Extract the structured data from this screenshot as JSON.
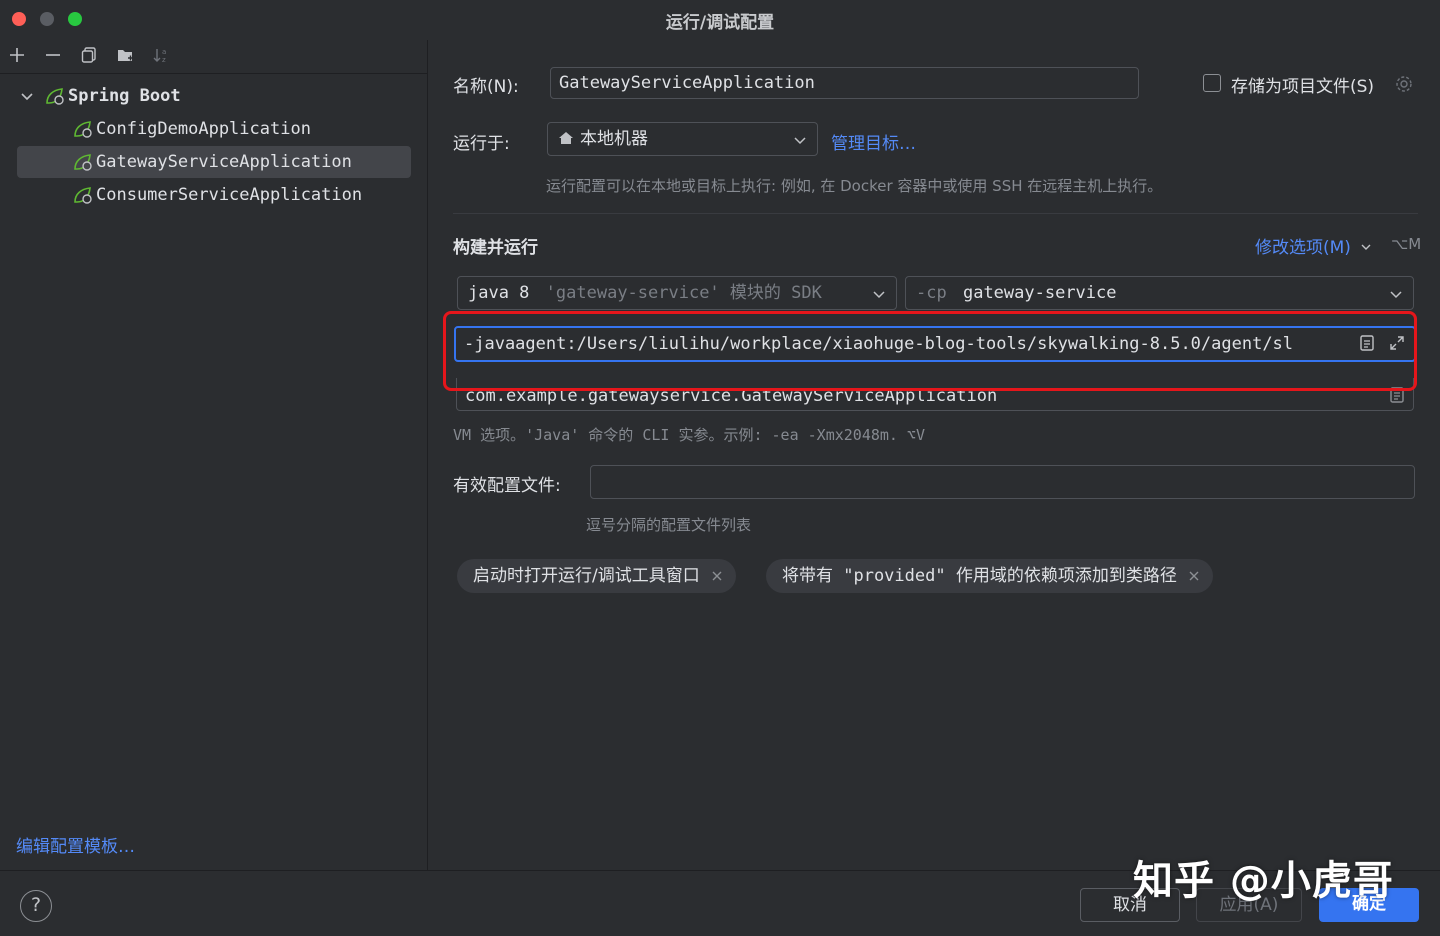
{
  "window": {
    "title": "运行/调试配置"
  },
  "sidebar": {
    "root": {
      "label": "Spring Boot"
    },
    "items": [
      {
        "label": "ConfigDemoApplication",
        "selected": false
      },
      {
        "label": "GatewayServiceApplication",
        "selected": true
      },
      {
        "label": "ConsumerServiceApplication",
        "selected": false
      }
    ],
    "edit_templates": "编辑配置模板…"
  },
  "form": {
    "name_label": "名称(N):",
    "name_value": "GatewayServiceApplication",
    "store_as_project_file": "存储为项目文件(S)",
    "run_on_label": "运行于:",
    "run_on_value": "本地机器",
    "manage_targets": "管理目标…",
    "run_on_hint": "运行配置可以在本地或目标上执行: 例如, 在 Docker 容器中或使用 SSH 在远程主机上执行。",
    "build_and_run": "构建并运行",
    "modify_options": "修改选项(M)",
    "modify_shortcut": "⌥M",
    "sdk_prefix": "java 8",
    "sdk_detail": "'gateway-service' 模块的 SDK",
    "cp_prefix": "-cp",
    "cp_value": "gateway-service",
    "vm_options": "-javaagent:/Users/liulihu/workplace/xiaohuge-blog-tools/skywalking-8.5.0/agent/sl",
    "main_class": "com.example.gatewayservice.GatewayServiceApplication",
    "vm_hint": "VM 选项。'Java' 命令的 CLI 实参。示例: -ea -Xmx2048m. ⌥V",
    "active_profiles_label": "有效配置文件:",
    "active_profiles_value": "",
    "active_profiles_hint": "逗号分隔的配置文件列表",
    "chips": [
      "启动时打开运行/调试工具窗口",
      "将带有 \"provided\" 作用域的依赖项添加到类路径"
    ]
  },
  "buttons": {
    "cancel": "取消",
    "apply": "应用(A)",
    "ok": "确定"
  },
  "watermark": "知乎 @小虎哥",
  "colors": {
    "accent": "#3574f0",
    "link": "#548af7",
    "highlight_box": "#e5161b",
    "background": "#2b2d30"
  }
}
